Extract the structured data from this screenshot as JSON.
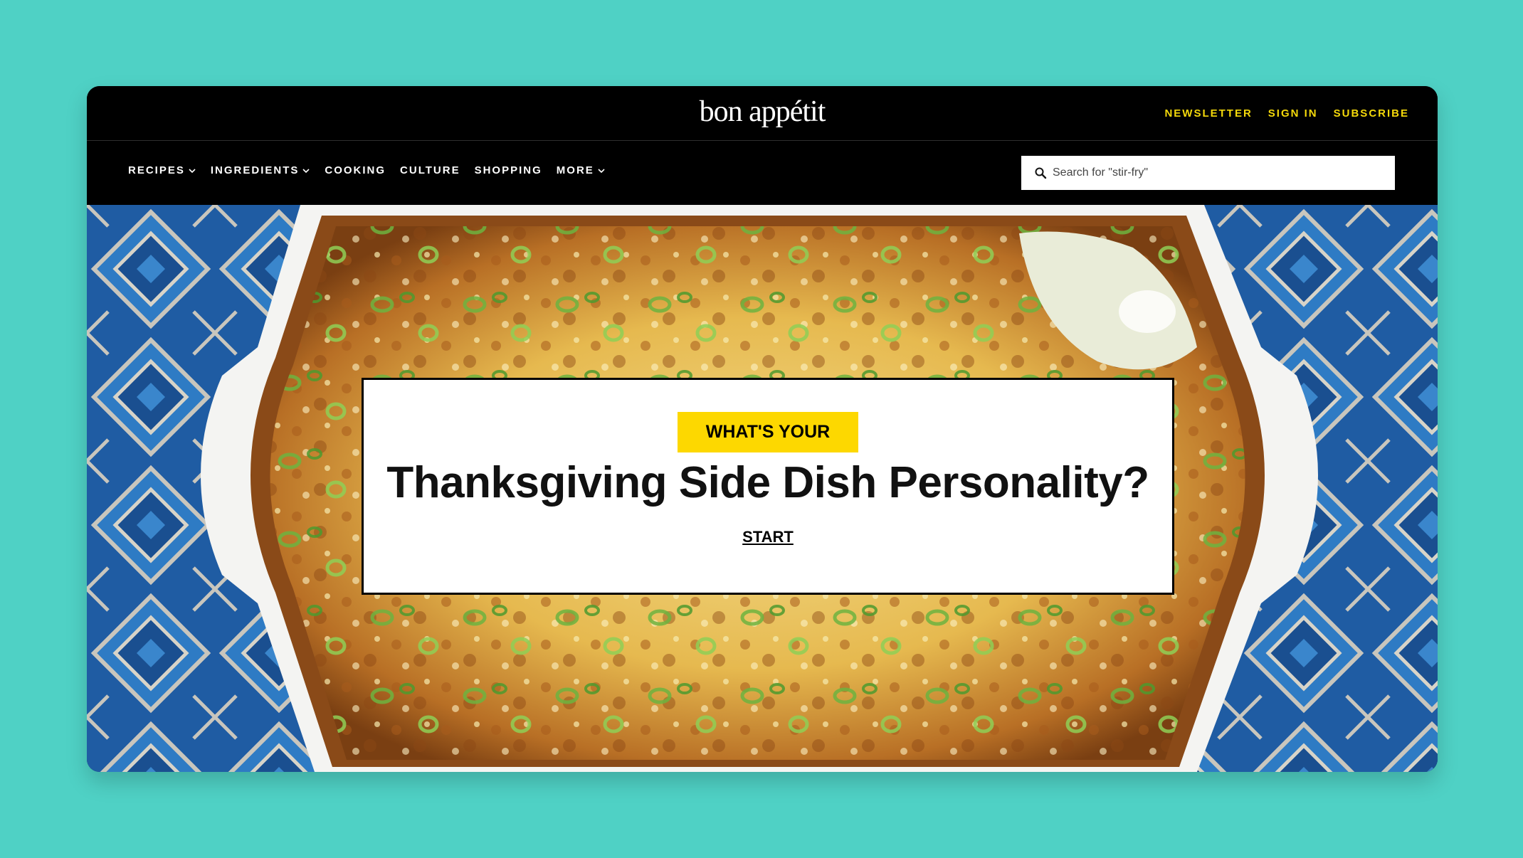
{
  "header": {
    "logo": "bon appétit",
    "links": [
      "NEWSLETTER",
      "SIGN IN",
      "SUBSCRIBE"
    ]
  },
  "nav": {
    "items": [
      {
        "label": "RECIPES",
        "has_menu": true
      },
      {
        "label": "INGREDIENTS",
        "has_menu": true
      },
      {
        "label": "COOKING",
        "has_menu": false
      },
      {
        "label": "CULTURE",
        "has_menu": false
      },
      {
        "label": "SHOPPING",
        "has_menu": false
      },
      {
        "label": "MORE",
        "has_menu": true
      }
    ],
    "search_placeholder": "Search for \"stir-fry\""
  },
  "hero": {
    "kicker": "WHAT'S YOUR",
    "title": "Thanksgiving Side Dish Personality?",
    "cta": "START"
  },
  "colors": {
    "background": "#4fd1c5",
    "accent_yellow": "#fdd800",
    "link_yellow": "#f5d90a",
    "header_bg": "#000000"
  },
  "icons": {
    "search": "search-icon",
    "chevron": "chevron-down-icon"
  }
}
